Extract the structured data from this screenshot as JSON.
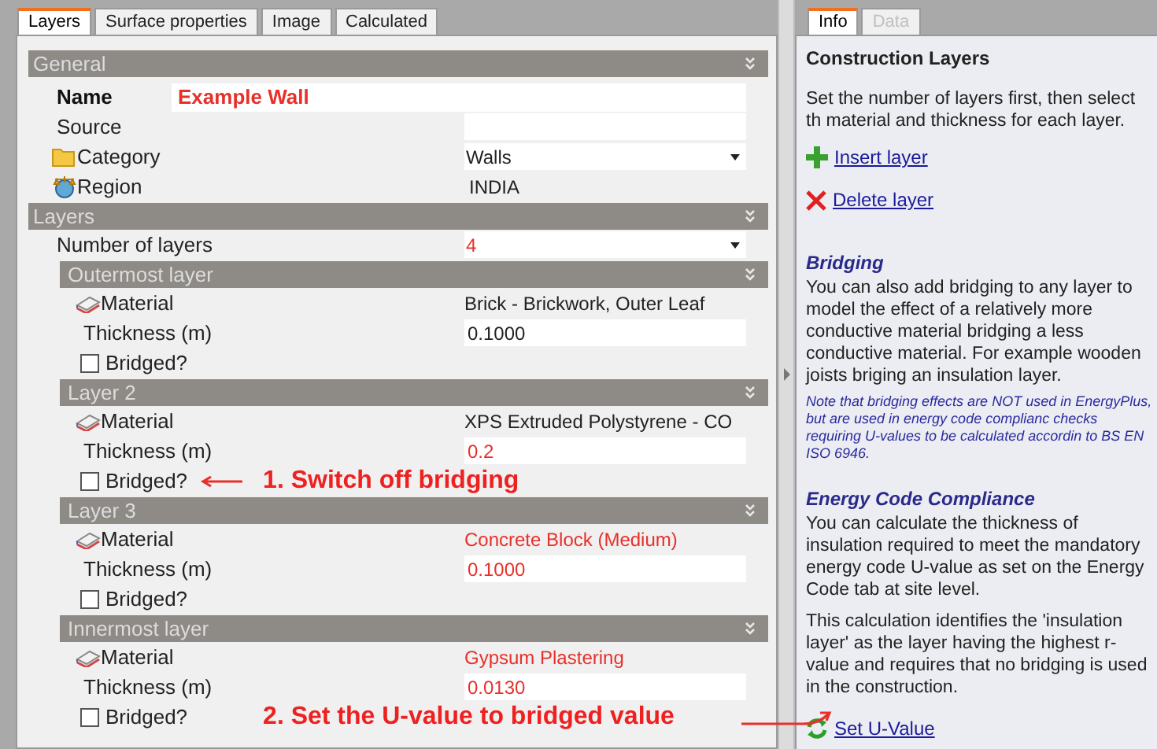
{
  "tabs": [
    {
      "label": "Layers",
      "selected": true
    },
    {
      "label": "Surface properties",
      "selected": false
    },
    {
      "label": "Image",
      "selected": false
    },
    {
      "label": "Calculated",
      "selected": false
    }
  ],
  "general": {
    "title": "General",
    "fields": [
      {
        "kind": "name",
        "label": "Name",
        "value": "Example Wall",
        "modified": true
      },
      {
        "kind": "input",
        "label": "Source"
      },
      {
        "kind": "category",
        "label": "Category",
        "value": "Walls",
        "modified": false
      },
      {
        "kind": "region",
        "label": "Region",
        "value": "INDIA",
        "modified": false
      }
    ]
  },
  "layers_section": {
    "title": "Layers",
    "number_of_layers": {
      "label": "Number of layers",
      "value": "4",
      "modified": true
    },
    "layers": [
      {
        "title": "Outermost layer",
        "material_label": "Material",
        "material": "Brick - Brickwork, Outer Leaf",
        "material_modified": false,
        "thickness_label": "Thickness (m)",
        "thickness": "0.1000",
        "thickness_modified": false,
        "bridged_label": "Bridged?",
        "bridged": false
      },
      {
        "title": "Layer 2",
        "material_label": "Material",
        "material": "XPS Extruded Polystyrene  - CO",
        "material_modified": false,
        "thickness_label": "Thickness (m)",
        "thickness": "0.2",
        "thickness_modified": true,
        "bridged_label": "Bridged?",
        "bridged": false,
        "annotation": "1. Switch off bridging"
      },
      {
        "title": "Layer 3",
        "material_label": "Material",
        "material": "Concrete Block (Medium)",
        "material_modified": true,
        "thickness_label": "Thickness (m)",
        "thickness": "0.1000",
        "thickness_modified": true,
        "bridged_label": "Bridged?",
        "bridged": false
      },
      {
        "title": "Innermost layer",
        "material_label": "Material",
        "material": "Gypsum Plastering",
        "material_modified": true,
        "thickness_label": "Thickness (m)",
        "thickness": "0.0130",
        "thickness_modified": true,
        "bridged_label": "Bridged?",
        "bridged": false,
        "annotation": "2. Set the U-value to bridged value"
      }
    ]
  },
  "info_tabs": [
    {
      "label": "Info",
      "selected": true,
      "disabled": false
    },
    {
      "label": "Data",
      "selected": false,
      "disabled": true
    }
  ],
  "info": {
    "title": "Construction Layers",
    "blocks": [
      {
        "kind": "text",
        "text": "Set the number of layers first, then select th material and thickness for each layer."
      },
      {
        "kind": "insert",
        "text": "Insert layer"
      },
      {
        "kind": "delete",
        "text": "Delete layer"
      },
      {
        "kind": "heading",
        "text": "Bridging"
      },
      {
        "kind": "body",
        "text": "You can also add bridging to any layer to model the effect of a relatively more conductive material bridging a less conductive material.  For example wooden joists briging an insulation layer."
      },
      {
        "kind": "note",
        "text": "Note that bridging effects are NOT used in EnergyPlus, but are used in energy code complianc checks requiring U-values to be calculated accordin to BS EN ISO 6946."
      },
      {
        "kind": "heading",
        "text": "Energy Code Compliance"
      },
      {
        "kind": "body",
        "text": "You can calculate the thickness of insulation required to meet the mandatory energy code U-value as set on the Energy Code tab at site level."
      },
      {
        "kind": "text",
        "text": "This calculation identifies the 'insulation layer' as the layer having the highest r-value and requires that no bridging is used in the construction."
      },
      {
        "kind": "refresh",
        "text": "Set U-Value"
      }
    ]
  }
}
